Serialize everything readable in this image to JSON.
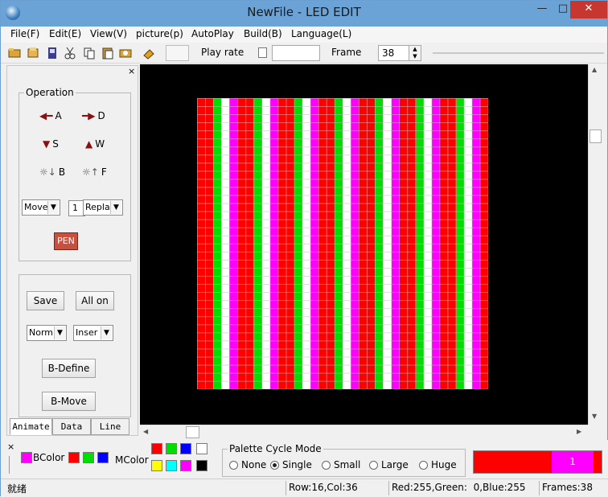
{
  "window": {
    "title": "NewFile - LED EDIT",
    "minimize": "—",
    "maximize": "□",
    "close": "✕"
  },
  "menu": [
    "File(F)",
    "Edit(E)",
    "View(V)",
    "picture(p)",
    "AutoPlay",
    "Build(B)",
    "Language(L)"
  ],
  "toolbar": {
    "icons": [
      "open-icon",
      "folder-icon",
      "save-icon",
      "cut-icon",
      "copy-icon",
      "paste-icon",
      "import-icon",
      "paint-icon"
    ],
    "play_rate_label": "Play rate",
    "play_rate_value": "",
    "frame_label": "Frame",
    "frame_value": "38"
  },
  "left_panel": {
    "close": "×",
    "operation_label": "Operation",
    "ops": [
      {
        "glyph": "◀━",
        "label": "A"
      },
      {
        "glyph": "━▶",
        "label": "D"
      },
      {
        "glyph": "▼",
        "label": "S"
      },
      {
        "glyph": "▲",
        "label": "W"
      },
      {
        "glyph": "☼↓",
        "label": "B"
      },
      {
        "glyph": "☼↑",
        "label": "F"
      }
    ],
    "move_select": "Move",
    "step_value": "1",
    "mode_select": "Repla",
    "pen_label": "PEN",
    "save_label": "Save",
    "allon_label": "All on",
    "norm_select": "Norm",
    "insert_select": "Inser",
    "bdefine_label": "B-Define",
    "bmove_label": "B-Move"
  },
  "tabs": [
    "Animate",
    "Data",
    "Line"
  ],
  "led_matrix": {
    "rows": 36,
    "cols": 36,
    "column_colors": [
      "#ff0000",
      "#ff0000",
      "#00dd00",
      "#ffffff",
      "#ff00ff",
      "#ff0000",
      "#ff0000",
      "#00dd00",
      "#ffffff",
      "#ff00ff",
      "#ff0000",
      "#ff0000",
      "#00dd00",
      "#ffffff",
      "#ff00ff",
      "#ff0000",
      "#ff0000",
      "#00dd00",
      "#ffffff",
      "#ff00ff",
      "#ff0000",
      "#ff0000",
      "#00dd00",
      "#ffffff",
      "#ff00ff",
      "#ff0000",
      "#ff0000",
      "#00dd00",
      "#ffffff",
      "#ff00ff",
      "#ff0000",
      "#ff0000",
      "#00dd00",
      "#ffffff",
      "#ff00ff",
      "#ff0000"
    ]
  },
  "bottom": {
    "bcolor_label": "BColor",
    "bcolor_swatch": "#ff00ff",
    "palette": [
      "#ff0000",
      "#00dd00",
      "#0000ff"
    ],
    "mcolor_label": "MColor",
    "mcolor_swatches": [
      "#ff0000",
      "#00dd00",
      "#0000ff",
      "#ffffff",
      "#ffff00",
      "#00ffff",
      "#ff00ff",
      "#000000"
    ],
    "palette_cycle_label": "Palette Cycle Mode",
    "cycle_modes": [
      {
        "label": "None",
        "selected": false
      },
      {
        "label": "Single",
        "selected": true
      },
      {
        "label": "Small",
        "selected": false
      },
      {
        "label": "Large",
        "selected": false
      },
      {
        "label": "Huge",
        "selected": false
      }
    ],
    "preview_value": "1"
  },
  "status": {
    "left": "就绪",
    "position": "Row:16,Col:36",
    "color": "Red:255,Green:  0,Blue:255",
    "frames": "Frames:38"
  }
}
